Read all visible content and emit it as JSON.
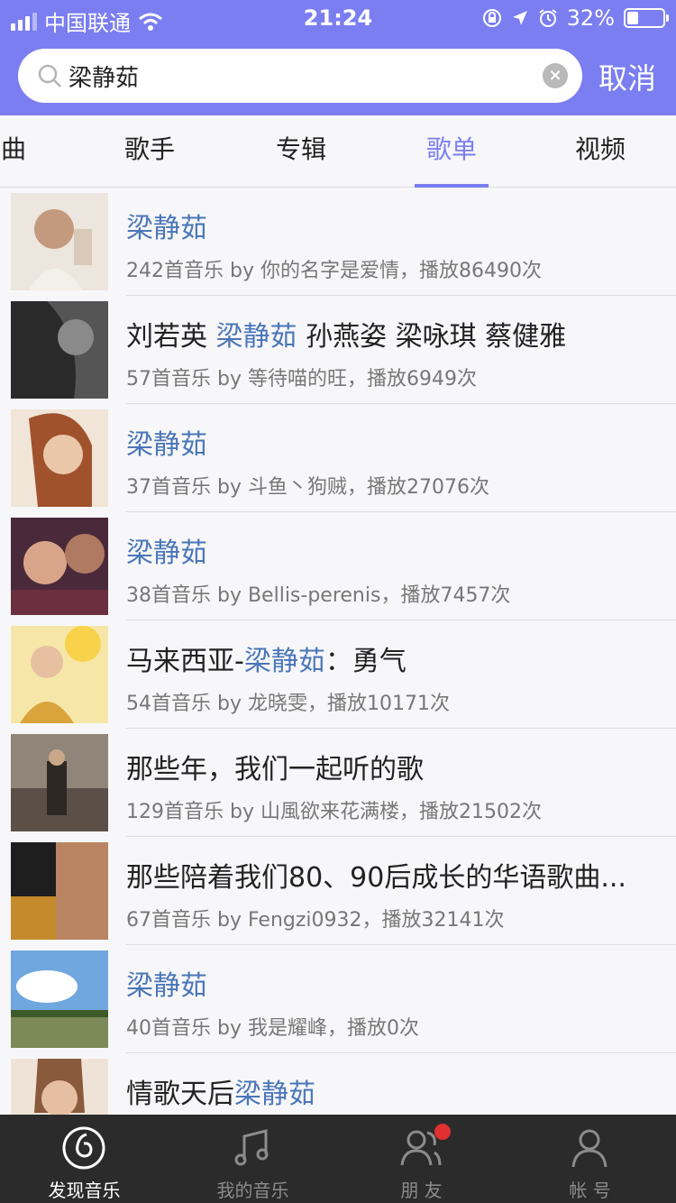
{
  "status": {
    "carrier": "中国联通",
    "time": "21:24",
    "battery": "32%"
  },
  "search": {
    "value": "梁静茹",
    "cancel_label": "取消"
  },
  "tabs": [
    {
      "label": "曲",
      "active": false
    },
    {
      "label": "歌手",
      "active": false
    },
    {
      "label": "专辑",
      "active": false
    },
    {
      "label": "歌单",
      "active": true
    },
    {
      "label": "视频",
      "active": false
    }
  ],
  "playlists": [
    {
      "title_parts": [
        {
          "t": "梁静茹",
          "hl": true
        }
      ],
      "subtitle": "242首音乐  by 你的名字是爱情，播放86490次"
    },
    {
      "title_parts": [
        {
          "t": "刘若英 ",
          "hl": false
        },
        {
          "t": "梁静茹",
          "hl": true
        },
        {
          "t": " 孙燕姿 梁咏琪 蔡健雅",
          "hl": false
        }
      ],
      "subtitle": "57首音乐  by 等待喵的旺，播放6949次"
    },
    {
      "title_parts": [
        {
          "t": "梁静茹",
          "hl": true
        }
      ],
      "subtitle": "37首音乐  by 斗鱼丶狗贼，播放27076次"
    },
    {
      "title_parts": [
        {
          "t": "梁静茹",
          "hl": true
        }
      ],
      "subtitle": "38首音乐  by Bellis-perenis，播放7457次"
    },
    {
      "title_parts": [
        {
          "t": "马来西亚-",
          "hl": false
        },
        {
          "t": "梁静茹",
          "hl": true
        },
        {
          "t": "：勇气",
          "hl": false
        }
      ],
      "subtitle": "54首音乐  by 龙晓雯，播放10171次"
    },
    {
      "title_parts": [
        {
          "t": "那些年，我们一起听的歌",
          "hl": false
        }
      ],
      "subtitle": "129首音乐  by 山風欲来花满楼，播放21502次"
    },
    {
      "title_parts": [
        {
          "t": "那些陪着我们80、90后成长的华语歌曲...",
          "hl": false
        }
      ],
      "subtitle": "67首音乐  by Fengzi0932，播放32141次"
    },
    {
      "title_parts": [
        {
          "t": "梁静茹",
          "hl": true
        }
      ],
      "subtitle": "40首音乐  by 我是耀峰，播放0次"
    },
    {
      "title_parts": [
        {
          "t": "情歌天后",
          "hl": false
        },
        {
          "t": "梁静茹",
          "hl": true
        }
      ],
      "subtitle": ""
    }
  ],
  "tabbar": [
    {
      "label": "发现音乐",
      "icon": "music-disc-icon",
      "active": true
    },
    {
      "label": "我的音乐",
      "icon": "music-note-icon",
      "active": false
    },
    {
      "label": "朋 友",
      "icon": "friends-icon",
      "active": false,
      "badge": true
    },
    {
      "label": "帐 号",
      "icon": "account-icon",
      "active": false
    }
  ],
  "colors": {
    "accent": "#7b7ef0",
    "highlight": "#4a76b8",
    "tabbar_bg": "#2b2b2b",
    "badge": "#e0302f"
  }
}
